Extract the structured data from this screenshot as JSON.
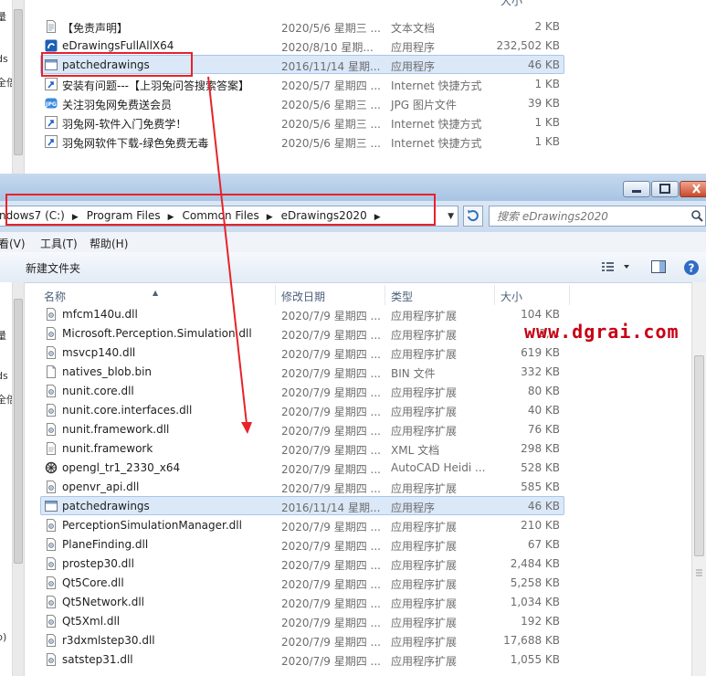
{
  "top_window": {
    "columns": {
      "name": "",
      "date": "",
      "type": "",
      "size": "大小"
    },
    "files": [
      {
        "name": "【免责声明】",
        "date": "2020/5/6 星期三 ...",
        "type": "文本文档",
        "size": "2 KB",
        "icon": "text-file-icon"
      },
      {
        "name": "eDrawingsFullAllX64",
        "date": "2020/8/10 星期...",
        "type": "应用程序",
        "size": "232,502 KB",
        "icon": "edrawings-app-icon"
      },
      {
        "name": "patchedrawings",
        "date": "2016/11/14 星期...",
        "type": "应用程序",
        "size": "46 KB",
        "icon": "exe-icon",
        "selected": true
      },
      {
        "name": "安装有问题---【上羽兔问答搜索答案】",
        "date": "2020/5/7 星期四 ...",
        "type": "Internet 快捷方式",
        "size": "1 KB",
        "icon": "shortcut-icon"
      },
      {
        "name": "关注羽兔网免费送会员",
        "date": "2020/5/6 星期三 ...",
        "type": "JPG 图片文件",
        "size": "39 KB",
        "icon": "jpg-icon"
      },
      {
        "name": "羽兔网-软件入门免费学！",
        "date": "2020/5/6 星期三 ...",
        "type": "Internet 快捷方式",
        "size": "1 KB",
        "icon": "shortcut-icon"
      },
      {
        "name": "羽兔网软件下载-绿色免费无毒",
        "date": "2020/5/6 星期三 ...",
        "type": "Internet 快捷方式",
        "size": "1 KB",
        "icon": "shortcut-icon"
      }
    ],
    "nav_chars": [
      "量",
      "ds",
      "全倍"
    ]
  },
  "address": {
    "crumbs": [
      "ndows7 (C:)",
      "Program Files",
      "Common Files",
      "eDrawings2020"
    ],
    "search_placeholder": "搜索 eDrawings2020"
  },
  "menu": {
    "view": "看(V)",
    "tools": "工具(T)",
    "help": "帮助(H)"
  },
  "toolbar": {
    "new_folder": "新建文件夹"
  },
  "columns": {
    "name": "名称",
    "date": "修改日期",
    "type": "类型",
    "size": "大小"
  },
  "nav_chars": [
    "量",
    "ds",
    "全倍",
    "b)"
  ],
  "watermark": "www.dgrai.com",
  "files": [
    {
      "name": "mfcm140u.dll",
      "date": "2020/7/9 星期四 ...",
      "type": "应用程序扩展",
      "size": "104 KB",
      "icon": "dll-icon"
    },
    {
      "name": "Microsoft.Perception.Simulation.dll",
      "date": "2020/7/9 星期四 ...",
      "type": "应用程序扩展",
      "size": "3,...",
      "icon": "dll-icon"
    },
    {
      "name": "msvcp140.dll",
      "date": "2020/7/9 星期四 ...",
      "type": "应用程序扩展",
      "size": "619 KB",
      "icon": "dll-icon"
    },
    {
      "name": "natives_blob.bin",
      "date": "2020/7/9 星期四 ...",
      "type": "BIN 文件",
      "size": "332 KB",
      "icon": "blank-file-icon"
    },
    {
      "name": "nunit.core.dll",
      "date": "2020/7/9 星期四 ...",
      "type": "应用程序扩展",
      "size": "80 KB",
      "icon": "dll-icon"
    },
    {
      "name": "nunit.core.interfaces.dll",
      "date": "2020/7/9 星期四 ...",
      "type": "应用程序扩展",
      "size": "40 KB",
      "icon": "dll-icon"
    },
    {
      "name": "nunit.framework.dll",
      "date": "2020/7/9 星期四 ...",
      "type": "应用程序扩展",
      "size": "76 KB",
      "icon": "dll-icon"
    },
    {
      "name": "nunit.framework",
      "date": "2020/7/9 星期四 ...",
      "type": "XML 文档",
      "size": "298 KB",
      "icon": "xml-file-icon"
    },
    {
      "name": "opengl_tr1_2330_x64",
      "date": "2020/7/9 星期四 ...",
      "type": "AutoCAD Heidi ...",
      "size": "528 KB",
      "icon": "autocad-heidi-icon"
    },
    {
      "name": "openvr_api.dll",
      "date": "2020/7/9 星期四 ...",
      "type": "应用程序扩展",
      "size": "585 KB",
      "icon": "dll-icon"
    },
    {
      "name": "patchedrawings",
      "date": "2016/11/14 星期...",
      "type": "应用程序",
      "size": "46 KB",
      "icon": "exe-icon",
      "selected": true
    },
    {
      "name": "PerceptionSimulationManager.dll",
      "date": "2020/7/9 星期四 ...",
      "type": "应用程序扩展",
      "size": "210 KB",
      "icon": "dll-icon"
    },
    {
      "name": "PlaneFinding.dll",
      "date": "2020/7/9 星期四 ...",
      "type": "应用程序扩展",
      "size": "67 KB",
      "icon": "dll-icon"
    },
    {
      "name": "prostep30.dll",
      "date": "2020/7/9 星期四 ...",
      "type": "应用程序扩展",
      "size": "2,484 KB",
      "icon": "dll-icon"
    },
    {
      "name": "Qt5Core.dll",
      "date": "2020/7/9 星期四 ...",
      "type": "应用程序扩展",
      "size": "5,258 KB",
      "icon": "dll-icon"
    },
    {
      "name": "Qt5Network.dll",
      "date": "2020/7/9 星期四 ...",
      "type": "应用程序扩展",
      "size": "1,034 KB",
      "icon": "dll-icon"
    },
    {
      "name": "Qt5Xml.dll",
      "date": "2020/7/9 星期四 ...",
      "type": "应用程序扩展",
      "size": "192 KB",
      "icon": "dll-icon"
    },
    {
      "name": "r3dxmlstep30.dll",
      "date": "2020/7/9 星期四 ...",
      "type": "应用程序扩展",
      "size": "17,688 KB",
      "icon": "dll-icon"
    },
    {
      "name": "satstep31.dll",
      "date": "2020/7/9 星期四 ...",
      "type": "应用程序扩展",
      "size": "1,055 KB",
      "icon": "dll-icon"
    }
  ],
  "colors": {
    "annotation_red": "#e8222a",
    "selection": "#dbe8f8",
    "watermark": "#c80012"
  }
}
